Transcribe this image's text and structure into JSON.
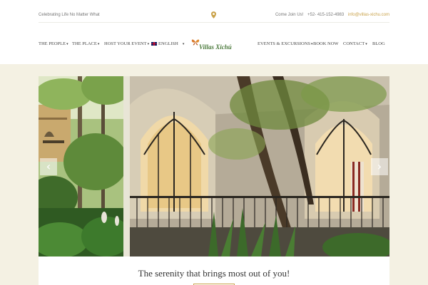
{
  "topbar": {
    "tagline": "Celebrating Life No Matter What",
    "join": "Come Join Us!",
    "phone": "+52- 415-152-4983",
    "email": "info@villas-xichu.com"
  },
  "nav": {
    "people": "THE PEOPLE",
    "place": "THE PLACE",
    "host": "HOST YOUR EVENT",
    "lang": "ENGLISH",
    "events": "EVENTS & EXCURSIONS",
    "book": "BOOK NOW",
    "contact": "CONTACT",
    "blog": "BLOG"
  },
  "logo": {
    "text": "Villas Xichú"
  },
  "slider": {
    "prev": "‹",
    "next": "›"
  },
  "intro": {
    "title": "The serenity that brings most out of you!"
  },
  "colors": {
    "accent": "#c9a24a",
    "background": "#f4f1e3",
    "logo_green": "#4b7a3c"
  }
}
